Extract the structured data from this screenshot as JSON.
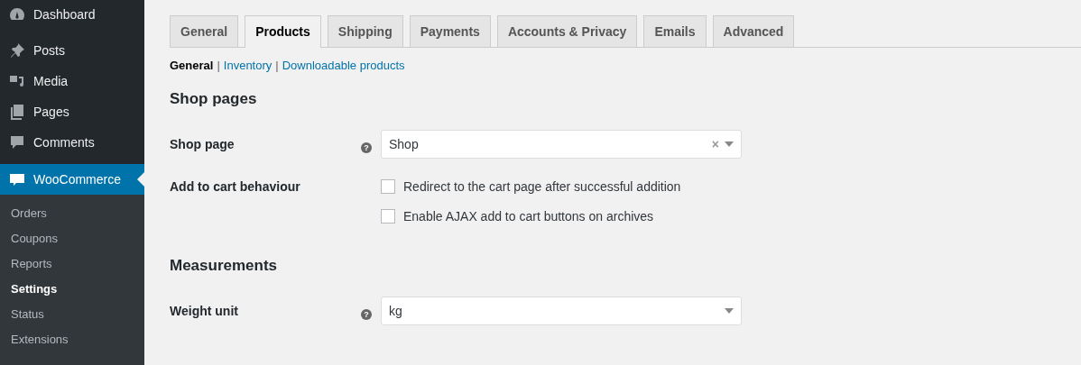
{
  "sidebar": {
    "items": [
      {
        "label": "Dashboard",
        "selected": false
      },
      {
        "label": "Posts",
        "selected": false
      },
      {
        "label": "Media",
        "selected": false
      },
      {
        "label": "Pages",
        "selected": false
      },
      {
        "label": "Comments",
        "selected": false
      },
      {
        "label": "WooCommerce",
        "selected": true
      }
    ],
    "submenu": [
      {
        "label": "Orders",
        "selected": false
      },
      {
        "label": "Coupons",
        "selected": false
      },
      {
        "label": "Reports",
        "selected": false
      },
      {
        "label": "Settings",
        "selected": true
      },
      {
        "label": "Status",
        "selected": false
      },
      {
        "label": "Extensions",
        "selected": false
      }
    ]
  },
  "tabs": [
    {
      "label": "General",
      "selected": false
    },
    {
      "label": "Products",
      "selected": true
    },
    {
      "label": "Shipping",
      "selected": false
    },
    {
      "label": "Payments",
      "selected": false
    },
    {
      "label": "Accounts & Privacy",
      "selected": false
    },
    {
      "label": "Emails",
      "selected": false
    },
    {
      "label": "Advanced",
      "selected": false
    }
  ],
  "subnav": {
    "separator": "|",
    "links": [
      {
        "label": "General",
        "selected": true
      },
      {
        "label": "Inventory",
        "selected": false
      },
      {
        "label": "Downloadable products",
        "selected": false
      }
    ]
  },
  "sections": [
    {
      "title": "Shop pages",
      "fields": [
        {
          "kind": "select",
          "label": "Shop page",
          "help_icon": "?",
          "value": "Shop",
          "clear_icon": "×"
        },
        {
          "kind": "checkboxes",
          "label": "Add to cart behaviour",
          "options": [
            {
              "label": "Redirect to the cart page after successful addition",
              "checked": false
            },
            {
              "label": "Enable AJAX add to cart buttons on archives",
              "checked": false
            }
          ]
        }
      ]
    },
    {
      "title": "Measurements",
      "fields": [
        {
          "kind": "select",
          "label": "Weight unit",
          "help_icon": "?",
          "value": "kg"
        }
      ]
    }
  ]
}
